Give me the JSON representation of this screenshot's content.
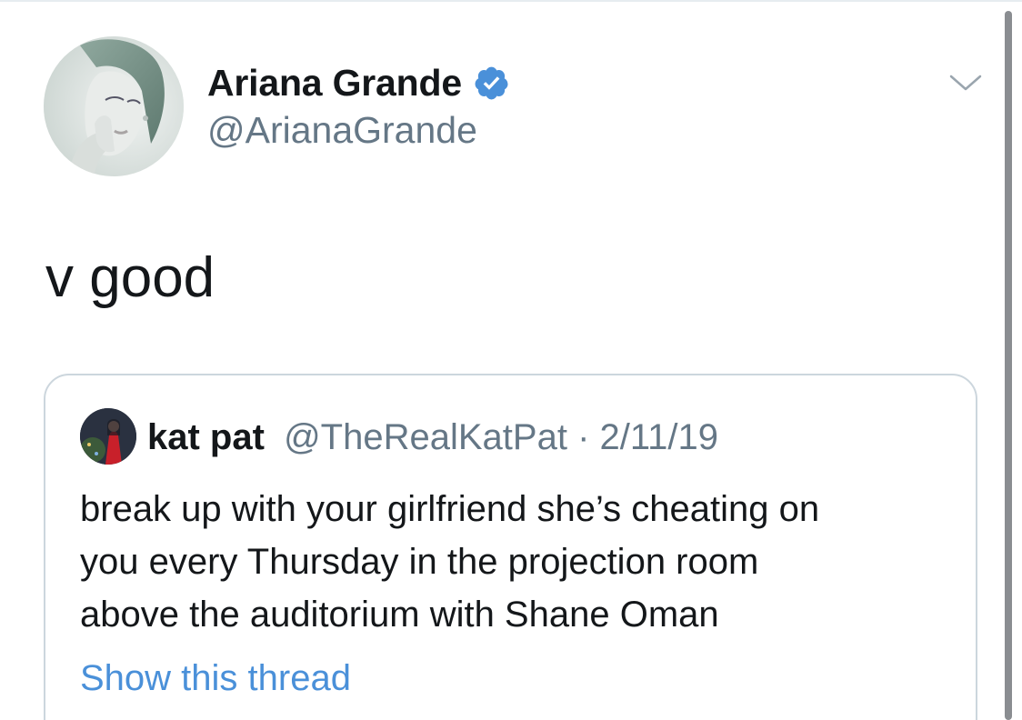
{
  "tweet": {
    "author": {
      "display_name": "Ariana Grande",
      "handle": "@ArianaGrande",
      "verified": true,
      "avatar_icon": "profile-photo",
      "verified_icon": "verified-badge-icon"
    },
    "menu_icon": "chevron-down-icon",
    "text": "v good"
  },
  "quoted_tweet": {
    "author": {
      "display_name": "kat pat",
      "handle": "@TheRealKatPat",
      "avatar_icon": "profile-photo"
    },
    "separator": "·",
    "date": "2/11/19",
    "lines": [
      "break up with your girlfriend she’s cheating on",
      "you every Thursday in the projection room",
      "above the auditorium with Shane Oman"
    ],
    "show_thread_label": "Show this thread"
  },
  "colors": {
    "text_primary": "#14171a",
    "text_secondary": "#657786",
    "link": "#4a90d9",
    "verified_badge": "#4a90d9",
    "card_border": "#ccd6dd"
  }
}
